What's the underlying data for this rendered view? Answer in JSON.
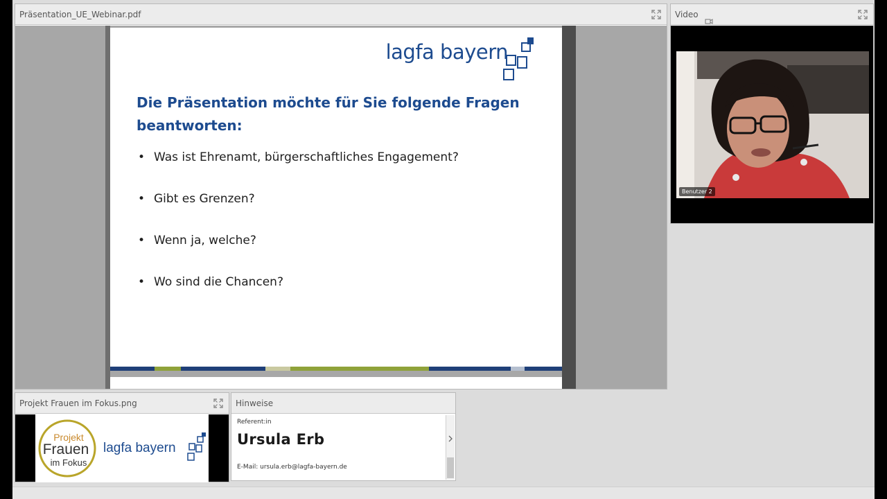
{
  "presentation_pod": {
    "title": "Präsentation_UE_Webinar.pdf",
    "slide": {
      "logo_text": "lagfa bayern",
      "title": "Die Präsentation möchte für Sie folgende Fragen beantworten:",
      "bullets": [
        "Was ist Ehrenamt, bürgerschaftliches Engagement?",
        "Gibt es Grenzen?",
        "Wenn ja, welche?",
        "Wo sind die Chancen?"
      ],
      "brand_color": "#1d4b8f"
    }
  },
  "video_pod": {
    "title": "Video",
    "participant_label": "Benutzer 2"
  },
  "image_pod": {
    "title": "Projekt Frauen im Fokus.png",
    "logo_projekt": "Projekt",
    "logo_frauen": "Frauen",
    "logo_imfokus": "im Fokus",
    "logo_lagfa": "lagfa bayern"
  },
  "notes_pod": {
    "title": "Hinweise",
    "role_label": "Referent:in",
    "speaker_name": "Ursula Erb",
    "email_line": "E-Mail: ursula.erb@lagfa-bayern.de"
  }
}
